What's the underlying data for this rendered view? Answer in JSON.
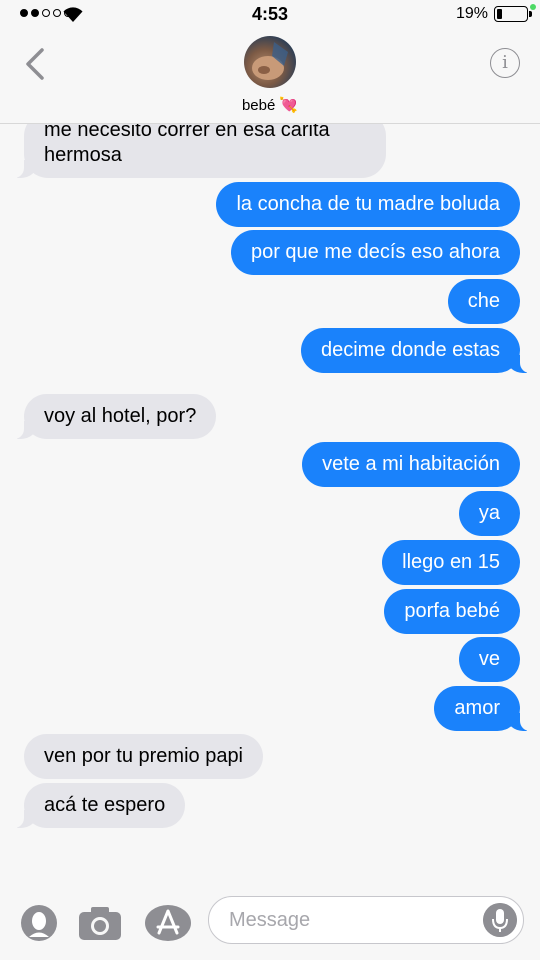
{
  "status_bar": {
    "time": "4:53",
    "battery_percent": "19%",
    "battery_level": 0.19,
    "signal_bars": 2,
    "signal_total": 5
  },
  "header": {
    "contact_name": "bebé",
    "heart_emoji": "💘",
    "icons": {
      "back": "chevron-left-icon",
      "info": "info-icon"
    }
  },
  "messages": [
    {
      "side": "received",
      "text_line1": "me necesito correr en esa carita",
      "text_line2": "hermosa"
    },
    {
      "side": "sent",
      "text": "la concha de tu madre boluda"
    },
    {
      "side": "sent",
      "text": "por que me decís eso ahora"
    },
    {
      "side": "sent",
      "text": "che"
    },
    {
      "side": "sent",
      "text": "decime donde estas"
    },
    {
      "side": "received",
      "text": "voy al hotel, por?"
    },
    {
      "side": "sent",
      "text": "vete a mi habitación"
    },
    {
      "side": "sent",
      "text": "ya"
    },
    {
      "side": "sent",
      "text": "llego en 15"
    },
    {
      "side": "sent",
      "text": "porfa bebé"
    },
    {
      "side": "sent",
      "text": "ve"
    },
    {
      "side": "sent",
      "text": "amor"
    },
    {
      "side": "received",
      "text": "ven por tu premio papi"
    },
    {
      "side": "received",
      "text": "acá te espero"
    }
  ],
  "input_bar": {
    "placeholder": "Message",
    "icons": [
      "memoji-icon",
      "camera-icon",
      "app-store-icon",
      "microphone-icon"
    ]
  },
  "colors": {
    "sent_bubble": "#1a82fb",
    "received_bubble": "#e5e5ea",
    "background": "#f7f7f7",
    "charging": "#4cd964"
  }
}
